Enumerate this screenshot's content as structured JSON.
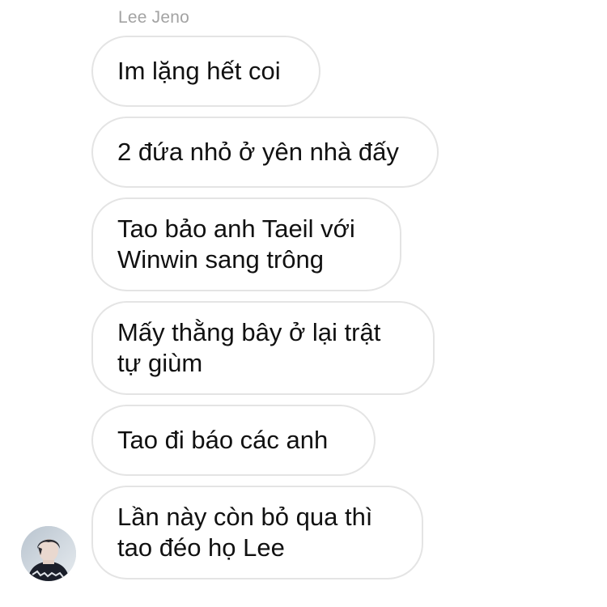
{
  "sender": {
    "name": "Lee Jeno"
  },
  "messages": [
    {
      "lines": [
        "Im lặng hết coi"
      ]
    },
    {
      "lines": [
        "2 đứa nhỏ ở yên nhà đấy"
      ]
    },
    {
      "lines": [
        "Tao bảo anh Taeil với",
        "Winwin sang trông"
      ]
    },
    {
      "lines": [
        "Mấy thằng bây ở lại trật",
        "tự giùm"
      ]
    },
    {
      "lines": [
        "Tao đi báo các anh"
      ]
    },
    {
      "lines": [
        "Lần này còn bỏ qua thì",
        "tao đéo họ Lee"
      ]
    }
  ],
  "avatar": {
    "icon": "profile-photo"
  },
  "colors": {
    "bubble_border": "#e4e4e4",
    "bubble_text": "#111111",
    "sender_name": "#a3a3a3",
    "background": "#ffffff"
  }
}
